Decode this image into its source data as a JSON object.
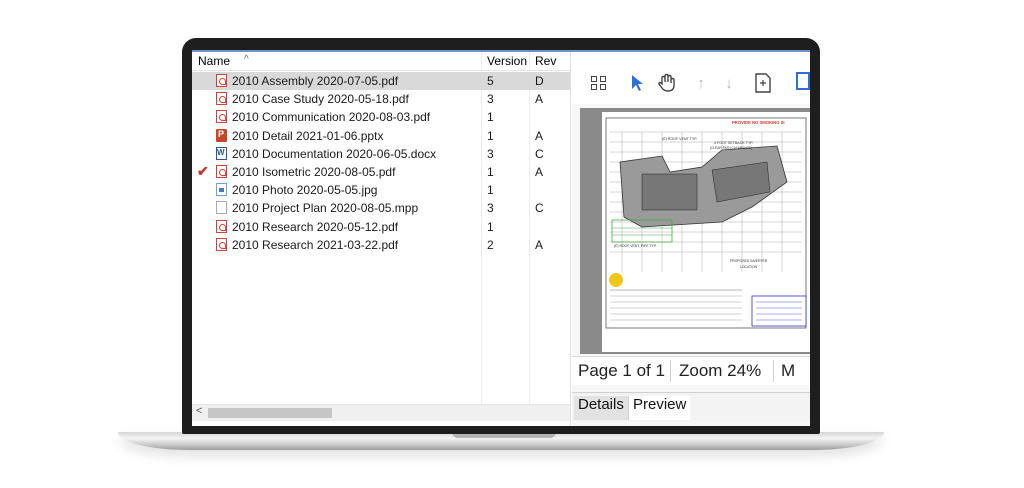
{
  "file_list": {
    "columns": {
      "name": "Name",
      "version": "Version",
      "rev": "Rev"
    },
    "sort_indicator": "^",
    "files": [
      {
        "icon": "pdf-file-icon",
        "name": "2010 Assembly 2020-07-05.pdf",
        "version": "5",
        "rev": "D",
        "selected": true,
        "checked": false
      },
      {
        "icon": "pdf-file-icon",
        "name": "2010 Case Study 2020-05-18.pdf",
        "version": "3",
        "rev": "A",
        "selected": false,
        "checked": false
      },
      {
        "icon": "pdf-file-icon",
        "name": "2010 Communication 2020-08-03.pdf",
        "version": "1",
        "rev": "",
        "selected": false,
        "checked": false
      },
      {
        "icon": "pptx-file-icon",
        "name": "2010 Detail 2021-01-06.pptx",
        "version": "1",
        "rev": "A",
        "selected": false,
        "checked": false
      },
      {
        "icon": "docx-file-icon",
        "name": "2010 Documentation 2020-06-05.docx",
        "version": "3",
        "rev": "C",
        "selected": false,
        "checked": false
      },
      {
        "icon": "pdf-file-icon",
        "name": "2010 Isometric 2020-08-05.pdf",
        "version": "1",
        "rev": "A",
        "selected": false,
        "checked": true
      },
      {
        "icon": "image-file-icon",
        "name": "2010 Photo 2020-05-05.jpg",
        "version": "1",
        "rev": "",
        "selected": false,
        "checked": false
      },
      {
        "icon": "generic-file-icon",
        "name": "2010 Project Plan 2020-08-05.mpp",
        "version": "3",
        "rev": "C",
        "selected": false,
        "checked": false
      },
      {
        "icon": "pdf-file-icon",
        "name": "2010 Research 2020-05-12.pdf",
        "version": "1",
        "rev": "",
        "selected": false,
        "checked": false
      },
      {
        "icon": "pdf-file-icon",
        "name": "2010 Research 2021-03-22.pdf",
        "version": "2",
        "rev": "A",
        "selected": false,
        "checked": false
      }
    ],
    "scroll_left_arrow": "<"
  },
  "preview": {
    "toolbar_icons": [
      "thumbnails-grid-icon",
      "pointer-arrow-icon",
      "pan-hand-icon",
      "arrow-up-icon",
      "arrow-down-icon",
      "fit-page-icon",
      "select-box-icon"
    ],
    "document_header_text": "PROVIDE NO SMOKING SI",
    "document_labels": [
      "(E) ROOF VENT TYP.",
      "4 FOOT SETBACK TYP.",
      "(CLEAR PATH CLEARANCE)",
      "(E) ROOF VENT, PIPE TYP.",
      "PROPOSED INVERTER",
      "LOCATION"
    ],
    "page_indicator": "Page 1 of 1",
    "zoom_indicator": "Zoom 24%",
    "status_extra": "M",
    "tabs": {
      "details": "Details",
      "preview": "Preview"
    },
    "accent_color": "#2f6fd6",
    "markup_color": "#3fae3f",
    "highlight_dot_color": "#f5c518"
  }
}
